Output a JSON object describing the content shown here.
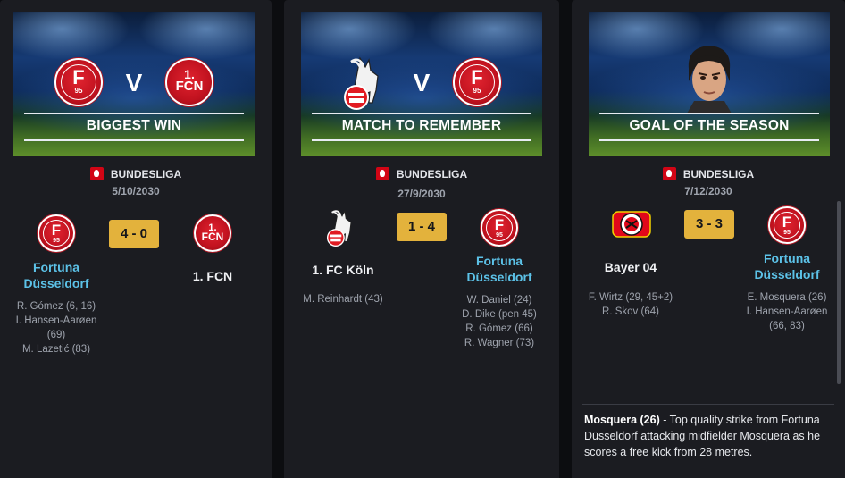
{
  "cards": [
    {
      "title": "BIGGEST WIN",
      "competition": "BUNDESLIGA",
      "date": "5/10/2030",
      "score": "4 - 0",
      "home": {
        "name": "Fortuna Düsseldorf",
        "name_line1": "Fortuna",
        "name_line2": "Düsseldorf",
        "crest": "fortuna-crest",
        "scorers": [
          "R. Gómez (6, 16)",
          "I. Hansen-Aarøen",
          "(69)",
          "M. Lazetić (83)"
        ]
      },
      "away": {
        "name": "1. FCN",
        "crest": "fcn-crest",
        "scorers": []
      }
    },
    {
      "title": "MATCH TO REMEMBER",
      "competition": "BUNDESLIGA",
      "date": "27/9/2030",
      "score": "1 - 4",
      "home": {
        "name": "1. FC Köln",
        "crest": "koln-crest",
        "scorers": [
          "M. Reinhardt (43)"
        ]
      },
      "away": {
        "name": "Fortuna Düsseldorf",
        "name_line1": "Fortuna",
        "name_line2": "Düsseldorf",
        "crest": "fortuna-crest",
        "scorers": [
          "W. Daniel (24)",
          "D. Dike (pen 45)",
          "R. Gómez (66)",
          "R. Wagner (73)"
        ]
      }
    },
    {
      "title": "GOAL OF THE SEASON",
      "competition": "BUNDESLIGA",
      "date": "7/12/2030",
      "score": "3 - 3",
      "home": {
        "name": "Bayer 04",
        "crest": "leverkusen-crest",
        "scorers": [
          "F. Wirtz (29, 45+2)",
          "R. Skov (64)"
        ]
      },
      "away": {
        "name": "Fortuna Düsseldorf",
        "name_line1": "Fortuna",
        "name_line2": "Düsseldorf",
        "crest": "fortuna-crest",
        "scorers": [
          "E. Mosquera (26)",
          "I. Hansen-Aarøen",
          "(66, 83)"
        ]
      },
      "goal": {
        "player": "Mosquera (26)",
        "description": " - Top quality strike from Fortuna Düsseldorf attacking midfielder Mosquera as he scores a free kick from 28 metres."
      }
    }
  ],
  "banner_versus": "V",
  "crest_text": {
    "fortuna_top": "F",
    "fortuna_bottom": "95",
    "fcn_top": "1.",
    "fcn_bottom": "FCN"
  },
  "colors": {
    "score_bg": "#e3b23c",
    "team_highlight": "#5cc2e8",
    "card_bg": "#1b1c21",
    "fortuna_red": "#c1121f",
    "bundesliga_red": "#d20515"
  }
}
